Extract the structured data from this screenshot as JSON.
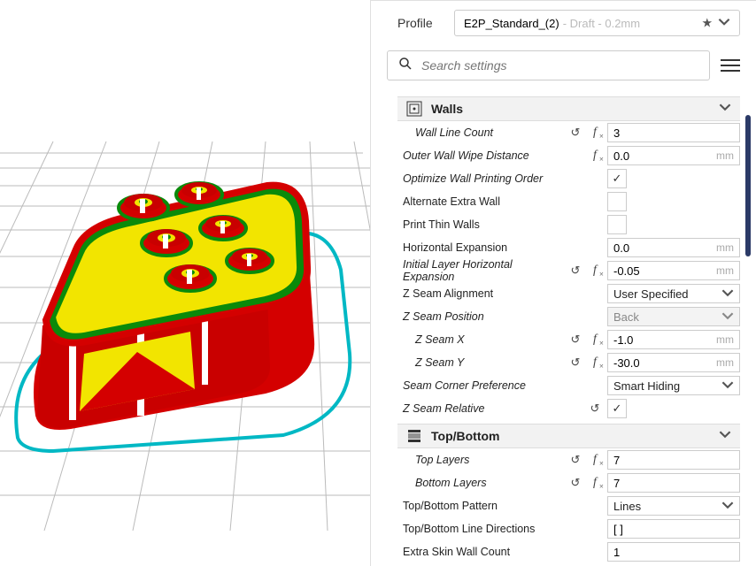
{
  "profile": {
    "label": "Profile",
    "name": "E2P_Standard_(2)",
    "suffix": " - Draft - 0.2mm"
  },
  "search": {
    "placeholder": "Search settings"
  },
  "sections": {
    "walls": {
      "title": "Walls",
      "wall_line_count": {
        "label": "Wall Line Count",
        "value": "3"
      },
      "outer_wall_wipe_distance": {
        "label": "Outer Wall Wipe Distance",
        "value": "0.0",
        "unit": "mm"
      },
      "optimize_wall_printing_order": {
        "label": "Optimize Wall Printing Order",
        "checked": true
      },
      "alternate_extra_wall": {
        "label": "Alternate Extra Wall",
        "checked": false
      },
      "print_thin_walls": {
        "label": "Print Thin Walls",
        "checked": false
      },
      "horizontal_expansion": {
        "label": "Horizontal Expansion",
        "value": "0.0",
        "unit": "mm"
      },
      "initial_layer_horizontal_expansion": {
        "label": "Initial Layer Horizontal Expansion",
        "value": "-0.05",
        "unit": "mm"
      },
      "z_seam_alignment": {
        "label": "Z Seam Alignment",
        "value": "User Specified"
      },
      "z_seam_position": {
        "label": "Z Seam Position",
        "value": "Back"
      },
      "z_seam_x": {
        "label": "Z Seam X",
        "value": "-1.0",
        "unit": "mm"
      },
      "z_seam_y": {
        "label": "Z Seam Y",
        "value": "-30.0",
        "unit": "mm"
      },
      "seam_corner_preference": {
        "label": "Seam Corner Preference",
        "value": "Smart Hiding"
      },
      "z_seam_relative": {
        "label": "Z Seam Relative",
        "checked": true
      }
    },
    "topbottom": {
      "title": "Top/Bottom",
      "top_layers": {
        "label": "Top Layers",
        "value": "7"
      },
      "bottom_layers": {
        "label": "Bottom Layers",
        "value": "7"
      },
      "top_bottom_pattern": {
        "label": "Top/Bottom Pattern",
        "value": "Lines"
      },
      "top_bottom_line_directions": {
        "label": "Top/Bottom Line Directions",
        "value": "[ ]"
      },
      "extra_skin_wall_count": {
        "label": "Extra Skin Wall Count",
        "value": "1"
      }
    }
  }
}
